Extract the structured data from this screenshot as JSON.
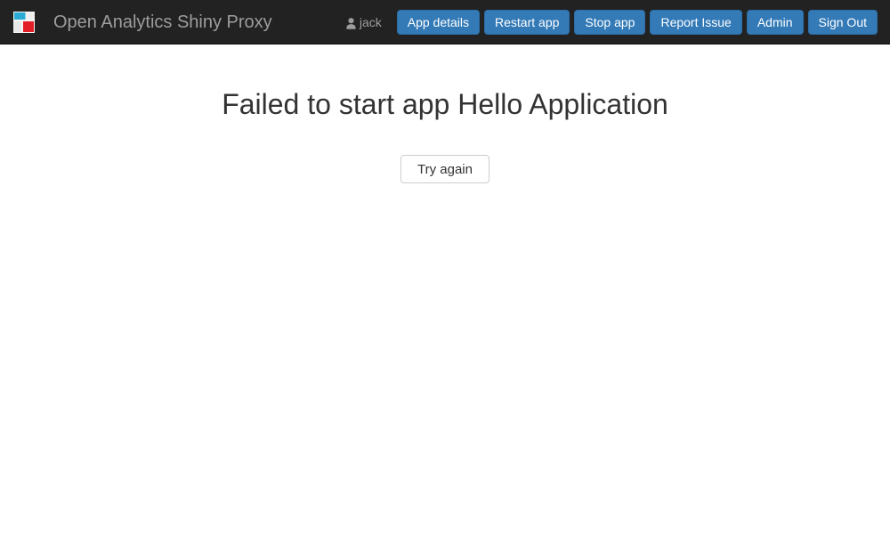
{
  "navbar": {
    "brand": {
      "text": "Open Analytics Shiny Proxy",
      "logo_icon": "openanalytics-logo-icon",
      "logo_colors": {
        "cyan": "#29ABD6",
        "red": "#E21F26",
        "light": "#E8E8E8",
        "white": "#F5F5F5"
      }
    },
    "user": {
      "icon": "user-icon",
      "name": "jack"
    },
    "buttons": [
      {
        "label": "App details",
        "name": "app-details-button"
      },
      {
        "label": "Restart app",
        "name": "restart-app-button"
      },
      {
        "label": "Stop app",
        "name": "stop-app-button"
      },
      {
        "label": "Report Issue",
        "name": "report-issue-button"
      },
      {
        "label": "Admin",
        "name": "admin-button"
      },
      {
        "label": "Sign Out",
        "name": "sign-out-button"
      }
    ],
    "colors": {
      "background": "#222222",
      "brand_text": "#9d9d9d",
      "button_bg": "#337ab7",
      "button_border": "#2e6da4",
      "button_text": "#ffffff"
    }
  },
  "main": {
    "title": "Failed to start app Hello Application",
    "retry_button_label": "Try again",
    "colors": {
      "background": "#ffffff",
      "title_text": "#333333",
      "retry_border": "#cccccc",
      "retry_text": "#333333"
    }
  }
}
